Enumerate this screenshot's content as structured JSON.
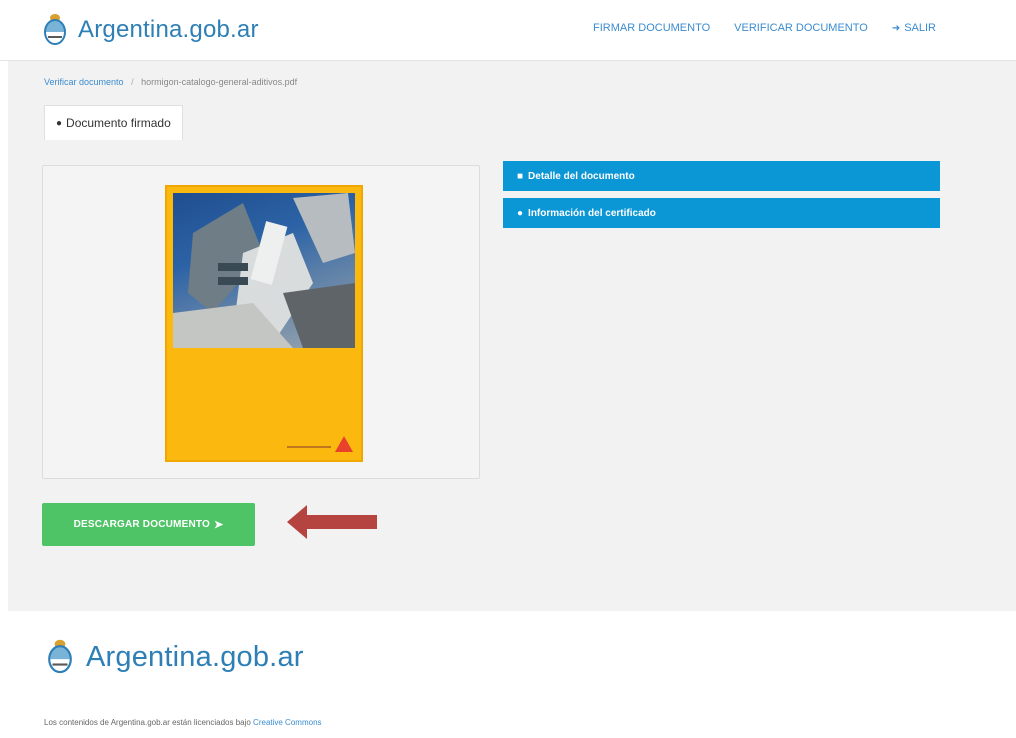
{
  "header": {
    "brand": "Argentina.gob.ar",
    "nav": {
      "sign": "FIRMAR DOCUMENTO",
      "verify": "VERIFICAR DOCUMENTO",
      "exit": "SALIR"
    }
  },
  "breadcrumb": {
    "parent": "Verificar documento",
    "separator": "/",
    "current": "hormigon-catalogo-general-aditivos.pdf"
  },
  "tab": {
    "label": "Documento firmado"
  },
  "accordion": {
    "details": "Detalle del documento",
    "certificate": "Información del certificado"
  },
  "download": {
    "label": "DESCARGAR DOCUMENTO"
  },
  "footer": {
    "brand": "Argentina.gob.ar",
    "text": "Los contenidos de Argentina.gob.ar están licenciados bajo",
    "link": "Creative Commons"
  },
  "colors": {
    "brand_blue": "#2d7fb6",
    "accordion_blue": "#0b96d5",
    "download_green": "#4ec467",
    "cover_yellow": "#fbb90f",
    "annotation_arrow": "#b5433f"
  },
  "icons": [
    "coat-of-arms-icon",
    "exit-icon",
    "user-icon",
    "file-icon",
    "info-icon",
    "download-icon",
    "annotation-arrow-icon"
  ]
}
